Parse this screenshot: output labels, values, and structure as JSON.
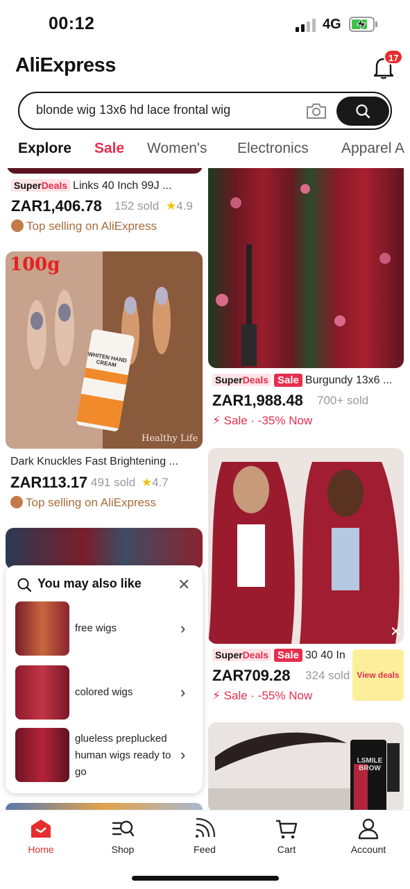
{
  "status": {
    "time": "00:12",
    "network": "4G"
  },
  "header": {
    "logo": "AliExpress",
    "notification_count": "17"
  },
  "search": {
    "query": "blonde wig 13x6 hd lace frontal wig"
  },
  "tabs": [
    {
      "label": "Explore"
    },
    {
      "label": "Sale"
    },
    {
      "label": "Women's"
    },
    {
      "label": "Electronics"
    },
    {
      "label": "Apparel A"
    }
  ],
  "products": [
    {
      "super": "Super",
      "deals": "Deals",
      "title": "Links 40 Inch 99J ...",
      "price": "ZAR1,406.78",
      "sold": "152 sold",
      "rating": "4.9",
      "promo": "Top selling on AliExpress"
    },
    {
      "super": "Super",
      "deals": "Deals",
      "sale_tag": "Sale",
      "title": "Burgundy 13x6 ...",
      "price": "ZAR1,988.48",
      "sold": "700+ sold",
      "promo": "Sale · -35% Now"
    },
    {
      "image_text_top": "100g",
      "image_text_tube": "WHITEN HAND CREAM",
      "image_text_brand": "Healthy Life",
      "title": "Dark Knuckles Fast Brightening ...",
      "price": "ZAR113.17",
      "sold": "491 sold",
      "rating": "4.7",
      "promo": "Top selling on AliExpress"
    },
    {
      "super": "Super",
      "deals": "Deals",
      "sale_tag": "Sale",
      "title": "30 40 In",
      "price": "ZAR709.28",
      "sold": "324 sold",
      "promo": "Sale · -55% Now"
    },
    {
      "image_text": "LSMILE BROW"
    }
  ],
  "popup": {
    "title": "You may also like",
    "suggestions": [
      {
        "label": "free wigs"
      },
      {
        "label": "colored wigs"
      },
      {
        "label": "glueless preplucked human wigs ready to go"
      }
    ]
  },
  "deals_badge": "View deals",
  "bottom_nav": [
    {
      "label": "Home",
      "icon": "home-icon"
    },
    {
      "label": "Shop",
      "icon": "shop-icon"
    },
    {
      "label": "Feed",
      "icon": "feed-icon"
    },
    {
      "label": "Cart",
      "icon": "cart-icon"
    },
    {
      "label": "Account",
      "icon": "account-icon"
    }
  ],
  "colors": {
    "accent": "#e62e4d",
    "brand_red": "#e62e2e",
    "promo_brown": "#a86a3a",
    "star": "#f7c000"
  }
}
